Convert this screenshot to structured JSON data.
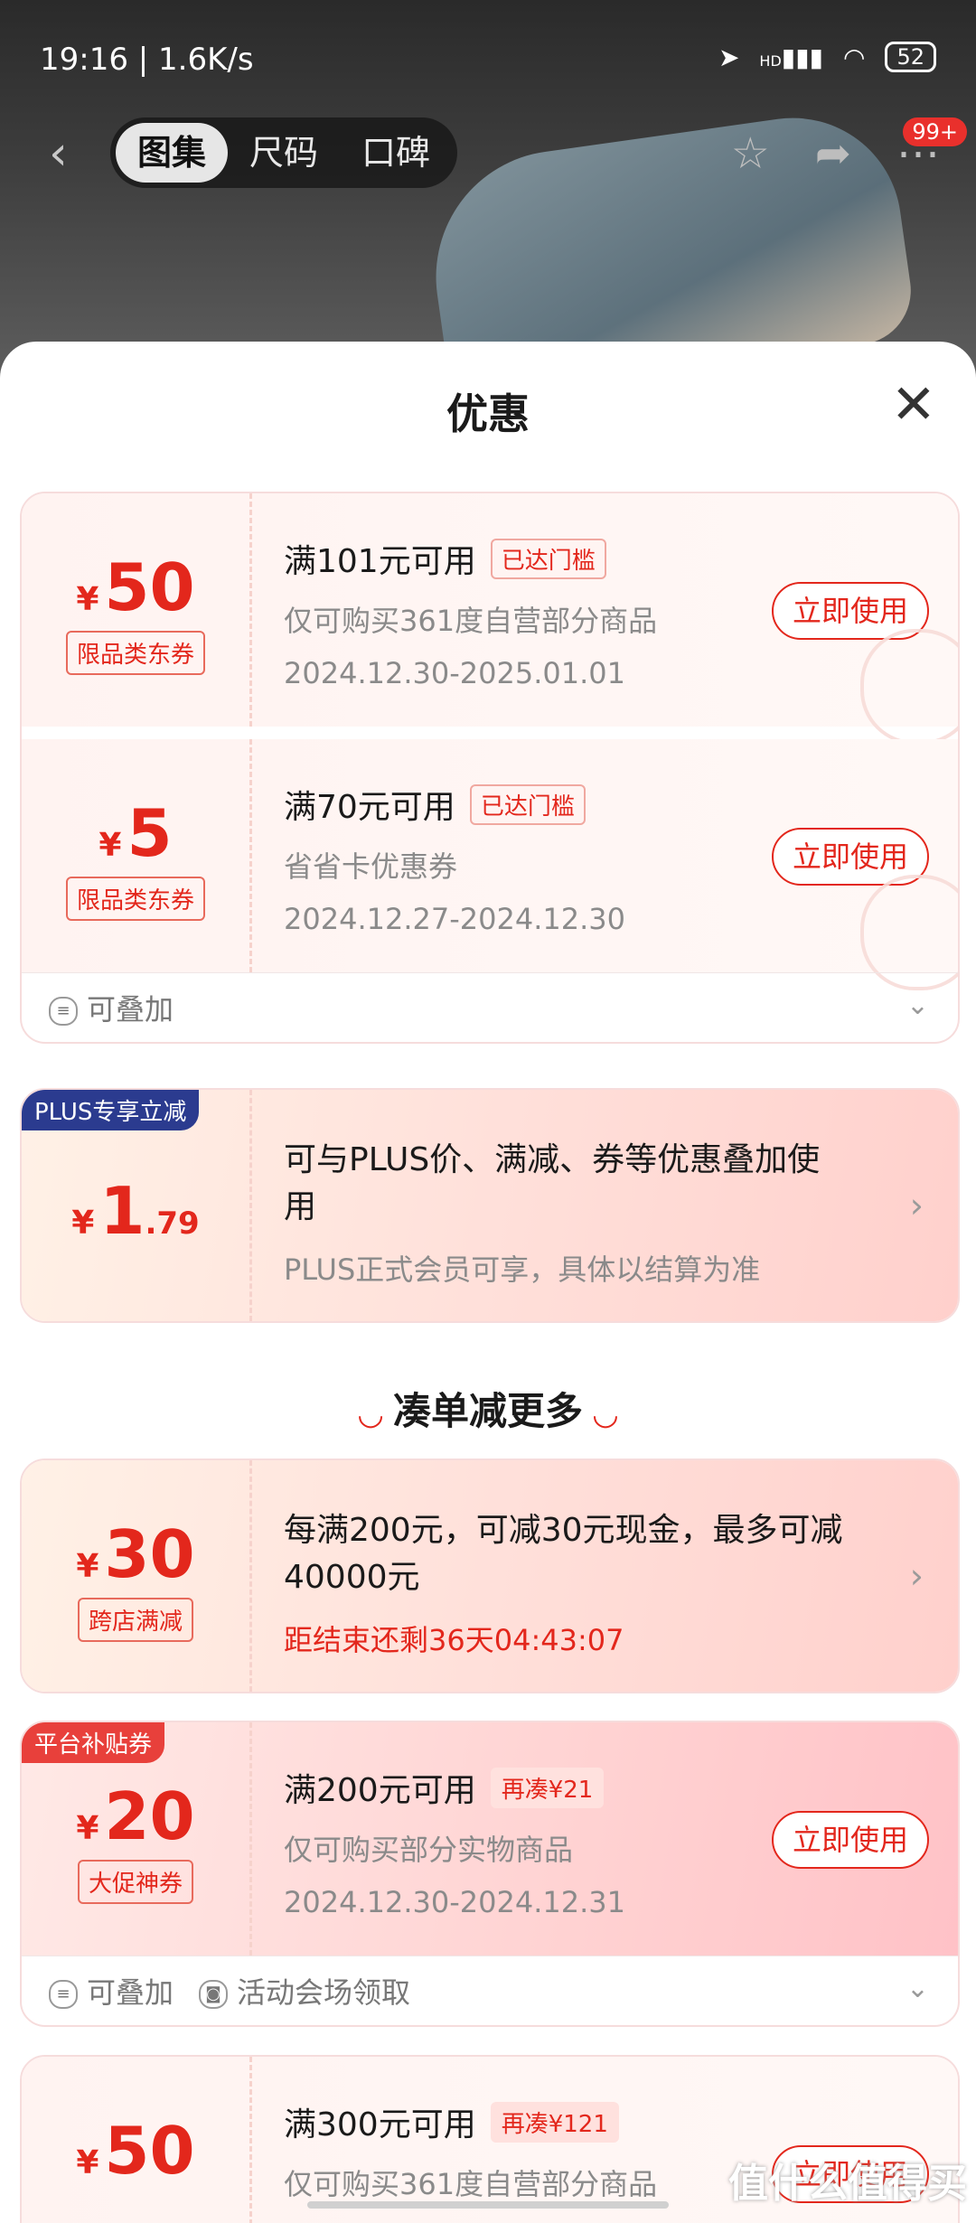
{
  "status": {
    "time": "19:16 | 1.6K/s",
    "network": "HD",
    "battery": "52"
  },
  "nav": {
    "tabs": [
      "图集",
      "尺码",
      "口碑"
    ],
    "badge": "99+"
  },
  "sheet": {
    "title": "优惠"
  },
  "coupons": [
    {
      "amount": "50",
      "currency": "¥",
      "tag": "限品类东券",
      "condition": "满101元可用",
      "pill": "已达门槛",
      "scope": "仅可购买361度自营部分商品",
      "dates": "2024.12.30-2025.01.01",
      "button": "立即使用"
    },
    {
      "amount": "5",
      "currency": "¥",
      "tag": "限品类东券",
      "condition": "满70元可用",
      "pill": "已达门槛",
      "scope": "省省卡优惠券",
      "dates": "2024.12.27-2024.12.30",
      "button": "立即使用"
    }
  ],
  "stack_footer": {
    "label": "可叠加"
  },
  "plus_card": {
    "corner": "PLUS专享立减",
    "currency": "¥",
    "amount_int": "1",
    "amount_dec": ".79",
    "desc": "可与PLUS价、满减、券等优惠叠加使用",
    "sub": "PLUS正式会员可享，具体以结算为准"
  },
  "section": {
    "title": "凑单减更多"
  },
  "cross_card": {
    "currency": "¥",
    "amount": "30",
    "tag": "跨店满减",
    "desc": "每满200元，可减30元现金，最多可减40000元",
    "countdown": "距结束还剩36天04:43:07"
  },
  "platform_card": {
    "corner": "平台补贴券",
    "currency": "¥",
    "amount": "20",
    "tag": "大促神券",
    "condition": "满200元可用",
    "pill": "再凑¥21",
    "scope": "仅可购买部分实物商品",
    "dates": "2024.12.30-2024.12.31",
    "button": "立即使用"
  },
  "platform_footer": {
    "stack": "可叠加",
    "source": "活动会场领取"
  },
  "last_card": {
    "currency": "¥",
    "amount": "50",
    "condition": "满300元可用",
    "pill": "再凑¥121",
    "scope": "仅可购买361度自营部分商品",
    "button": "立即使用"
  },
  "watermark": "值什么值得买"
}
